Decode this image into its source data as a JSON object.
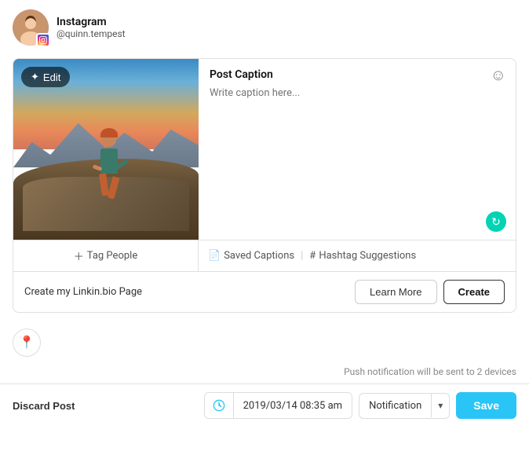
{
  "header": {
    "platform": "Instagram",
    "handle": "@quinn.tempest"
  },
  "post": {
    "edit_label": "Edit",
    "caption_label": "Post Caption",
    "caption_placeholder": "Write caption here...",
    "tag_people_label": "Tag People",
    "saved_captions_label": "Saved Captions",
    "hashtag_suggestions_label": "Hashtag Suggestions"
  },
  "linkin": {
    "text": "Create my Linkin.bio Page",
    "learn_more_label": "Learn More",
    "create_label": "Create"
  },
  "footer": {
    "discard_label": "Discard Post",
    "datetime": "2019/03/14 08:35 am",
    "notification_label": "Notification",
    "save_label": "Save",
    "push_notification_text": "Push notification will be sent to 2 devices"
  }
}
